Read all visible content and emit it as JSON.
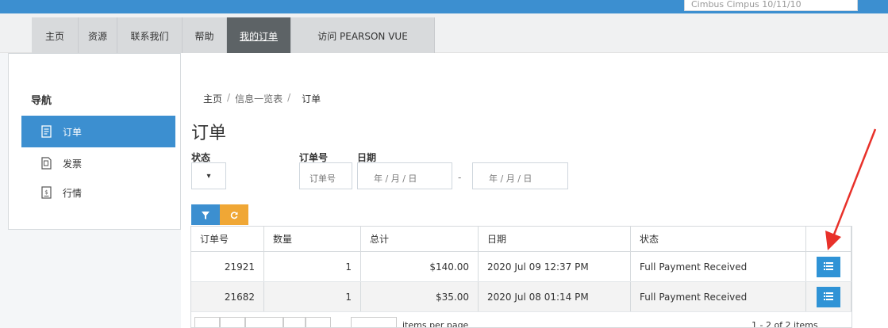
{
  "topbar": {
    "search_text": "Cimbus Cimpus 10/11/10"
  },
  "nav": {
    "items": [
      {
        "label": "主页"
      },
      {
        "label": "资源"
      },
      {
        "label": "联系我们"
      },
      {
        "label": "帮助"
      },
      {
        "label": "我的订单"
      },
      {
        "label": "访问 PEARSON VUE"
      }
    ],
    "active_index": 4
  },
  "sidebar": {
    "heading": "导航",
    "items": [
      {
        "label": "订单",
        "icon": "order-icon"
      },
      {
        "label": "发票",
        "icon": "invoice-icon"
      },
      {
        "label": "行情",
        "icon": "quote-icon"
      }
    ]
  },
  "breadcrumb": {
    "home": "主页",
    "sep1": "/",
    "list": "信息一览表",
    "sep2": "/",
    "current": "订单"
  },
  "page_title": "订单",
  "filters": {
    "status_label": "状态",
    "status_value": "▾",
    "order_no_label": "订单号",
    "order_no_placeholder": "订单号",
    "date_label": "日期",
    "date_from_placeholder": "年 / 月 / 日",
    "date_separator": "-",
    "date_to_placeholder": "年 / 月 / 日"
  },
  "table": {
    "columns": [
      "订单号",
      "数量",
      "总计",
      "日期",
      "状态"
    ],
    "rows": [
      {
        "order_no": "21921",
        "quantity": "1",
        "total": "$140.00",
        "date": "2020 Jul 09 12:37 PM",
        "status": "Full Payment Received"
      },
      {
        "order_no": "21682",
        "quantity": "1",
        "total": "$35.00",
        "date": "2020 Jul 08 01:14 PM",
        "status": "Full Payment Received"
      }
    ]
  },
  "pager": {
    "items_per_page": "items per page",
    "summary": "1 - 2 of 2 items"
  },
  "colors": {
    "brand_blue": "#3c8fd0",
    "reset_orange": "#f0a735",
    "arrow_red": "#e8312a"
  }
}
